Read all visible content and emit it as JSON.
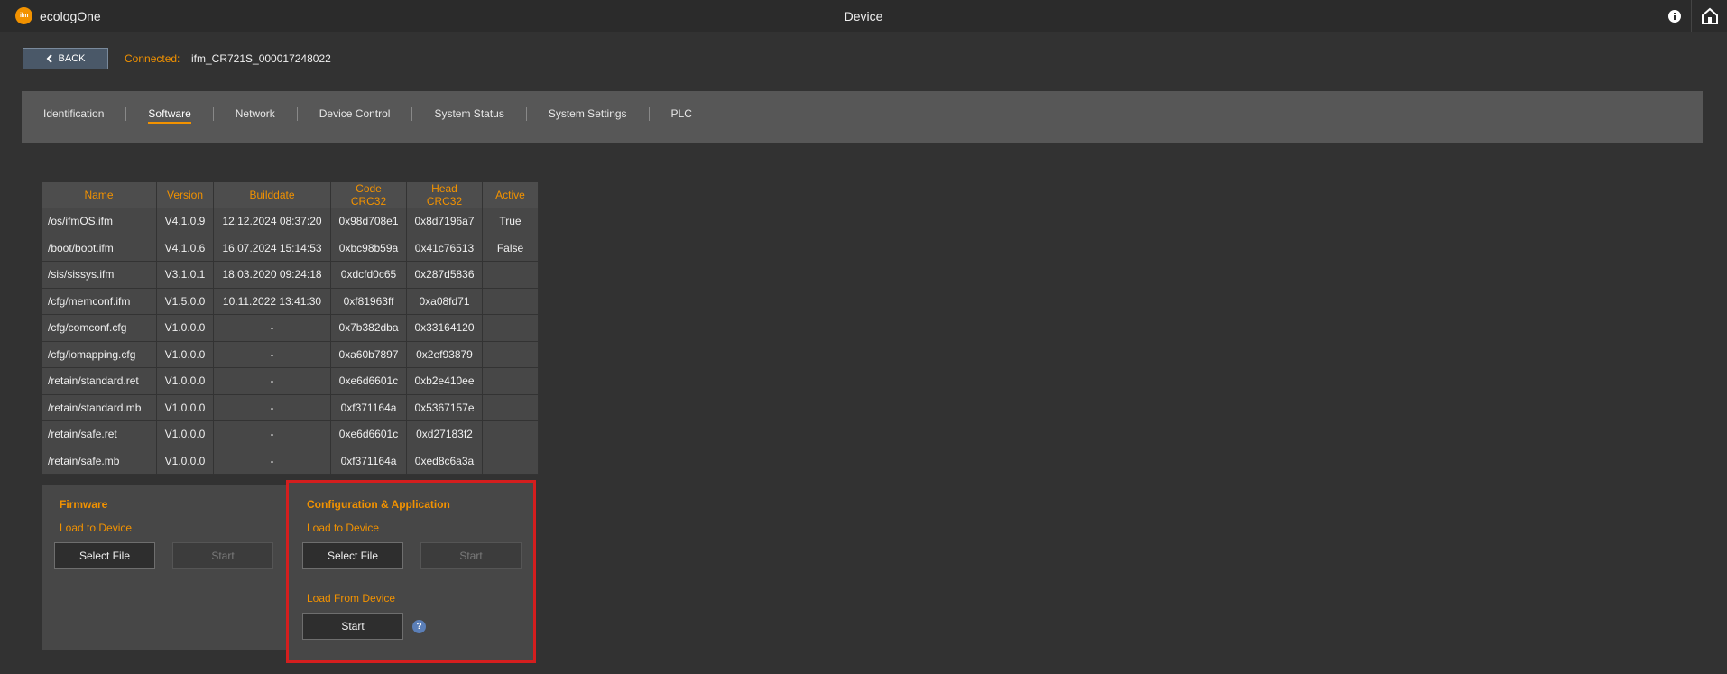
{
  "header": {
    "logo_text": "ifm",
    "app_name": "ecologOne",
    "title": "Device",
    "info_icon": "info-icon",
    "home_icon": "home-icon"
  },
  "connection": {
    "back_label": "BACK",
    "connected_label": "Connected:",
    "device_name": "ifm_CR721S_000017248022"
  },
  "tabs": [
    {
      "label": "Identification",
      "active": false
    },
    {
      "label": "Software",
      "active": true
    },
    {
      "label": "Network",
      "active": false
    },
    {
      "label": "Device Control",
      "active": false
    },
    {
      "label": "System Status",
      "active": false
    },
    {
      "label": "System Settings",
      "active": false
    },
    {
      "label": "PLC",
      "active": false
    }
  ],
  "table": {
    "columns": [
      "Name",
      "Version",
      "Builddate",
      "Code CRC32",
      "Head CRC32",
      "Active"
    ],
    "rows": [
      [
        "/os/ifmOS.ifm",
        "V4.1.0.9",
        "12.12.2024 08:37:20",
        "0x98d708e1",
        "0x8d7196a7",
        "True"
      ],
      [
        "/boot/boot.ifm",
        "V4.1.0.6",
        "16.07.2024 15:14:53",
        "0xbc98b59a",
        "0x41c76513",
        "False"
      ],
      [
        "/sis/sissys.ifm",
        "V3.1.0.1",
        "18.03.2020 09:24:18",
        "0xdcfd0c65",
        "0x287d5836",
        ""
      ],
      [
        "/cfg/memconf.ifm",
        "V1.5.0.0",
        "10.11.2022 13:41:30",
        "0xf81963ff",
        "0xa08fd71",
        ""
      ],
      [
        "/cfg/comconf.cfg",
        "V1.0.0.0",
        "-",
        "0x7b382dba",
        "0x33164120",
        ""
      ],
      [
        "/cfg/iomapping.cfg",
        "V1.0.0.0",
        "-",
        "0xa60b7897",
        "0x2ef93879",
        ""
      ],
      [
        "/retain/standard.ret",
        "V1.0.0.0",
        "-",
        "0xe6d6601c",
        "0xb2e410ee",
        ""
      ],
      [
        "/retain/standard.mb",
        "V1.0.0.0",
        "-",
        "0xf371164a",
        "0x5367157e",
        ""
      ],
      [
        "/retain/safe.ret",
        "V1.0.0.0",
        "-",
        "0xe6d6601c",
        "0xd27183f2",
        ""
      ],
      [
        "/retain/safe.mb",
        "V1.0.0.0",
        "-",
        "0xf371164a",
        "0xed8c6a3a",
        ""
      ]
    ]
  },
  "firmware": {
    "title": "Firmware",
    "load_to_device": "Load to Device",
    "select_file": "Select File",
    "start": "Start"
  },
  "config_app": {
    "title": "Configuration & Application",
    "load_to_device": "Load to Device",
    "select_file": "Select File",
    "start": "Start",
    "load_from_device": "Load From Device",
    "start_from": "Start",
    "help": "?"
  },
  "colors": {
    "accent": "#f29200",
    "highlight_border": "#d41e1e",
    "background": "#323232"
  }
}
